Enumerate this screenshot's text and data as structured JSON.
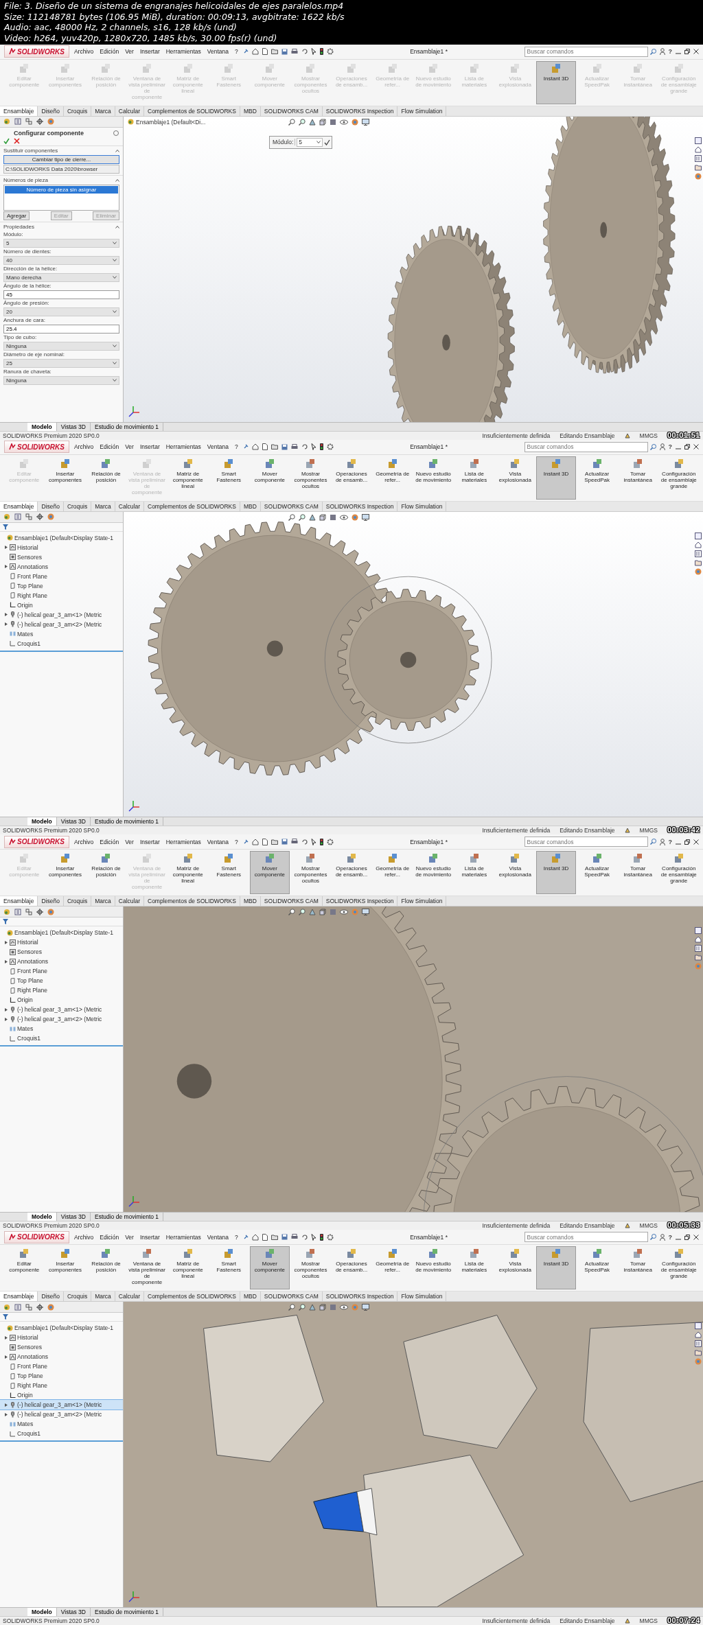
{
  "file_info": [
    "File: 3. Diseño de un sistema de engranajes helicoidales de ejes paralelos.mp4",
    "Size: 112148781 bytes (106.95 MiB), duration: 00:09:13, avgbitrate: 1622 kb/s",
    "Audio: aac, 48000 Hz, 2 channels, s16, 128 kb/s (und)",
    "Video: h264, yuv420p, 1280x720, 1485 kb/s, 30.00 fps(r) (und)"
  ],
  "frames": [
    {
      "timestamp": "00:01:51",
      "logo_text": "SOLIDWORKS",
      "menus": [
        "Archivo",
        "Edición",
        "Ver",
        "Insertar",
        "Herramientas",
        "Ventana",
        "?"
      ],
      "document_title": "Ensamblaje1 *",
      "search_placeholder": "Buscar comandos",
      "help_label": "?",
      "ribbon": [
        {
          "label": "Editar componente",
          "disabled": true,
          "selected": false
        },
        {
          "label": "Insertar componentes",
          "disabled": true,
          "selected": false
        },
        {
          "label": "Relación de posición",
          "disabled": true,
          "selected": false
        },
        {
          "label": "Ventana de vista preliminar de componente",
          "disabled": true,
          "selected": false
        },
        {
          "label": "Matriz de componente lineal",
          "disabled": true,
          "selected": false
        },
        {
          "label": "Smart Fasteners",
          "disabled": true,
          "selected": false
        },
        {
          "label": "Mover componente",
          "disabled": true,
          "selected": false
        },
        {
          "label": "Mostrar componentes ocultos",
          "disabled": true,
          "selected": false
        },
        {
          "label": "Operaciones de ensamb...",
          "disabled": true,
          "selected": false
        },
        {
          "label": "Geometría de refer...",
          "disabled": true,
          "selected": false
        },
        {
          "label": "Nuevo estudio de movimiento",
          "disabled": true,
          "selected": false
        },
        {
          "label": "Lista de materiales",
          "disabled": true,
          "selected": false
        },
        {
          "label": "Vista explosionada",
          "disabled": true,
          "selected": false
        },
        {
          "label": "Instant 3D",
          "disabled": false,
          "selected": true
        },
        {
          "label": "Actualizar SpeedPak",
          "disabled": true,
          "selected": false
        },
        {
          "label": "Tomar instantánea",
          "disabled": true,
          "selected": false
        },
        {
          "label": "Configuración de ensamblaje grande",
          "disabled": true,
          "selected": false
        }
      ],
      "tabs": [
        {
          "label": "Ensamblaje",
          "selected": true
        },
        {
          "label": "Diseño",
          "selected": false
        },
        {
          "label": "Croquis",
          "selected": false
        },
        {
          "label": "Marca",
          "selected": false
        },
        {
          "label": "Calcular",
          "selected": false
        },
        {
          "label": "Complementos de SOLIDWORKS",
          "selected": false
        },
        {
          "label": "MBD",
          "selected": false
        },
        {
          "label": "SOLIDWORKS CAM",
          "selected": false
        },
        {
          "label": "SOLIDWORKS Inspection",
          "selected": false
        },
        {
          "label": "Flow Simulation",
          "selected": false
        }
      ],
      "left_panel": {
        "kind": "property_manager",
        "title": "Configurar componente",
        "sections": [
          {
            "kind": "replace",
            "title": "Sustituir componentes",
            "button": "Cambiar tipo de cierre...",
            "path": "C:\\SOLIDWORKS Data 2020\\browser"
          },
          {
            "kind": "list",
            "title": "Números de pieza",
            "items": [
              {
                "label": "Número de pieza sin asignar",
                "selected": true
              }
            ],
            "buttons": [
              {
                "label": "Agregar",
                "disabled": false
              },
              {
                "label": "Editar",
                "disabled": true
              },
              {
                "label": "Eliminar",
                "disabled": true
              }
            ]
          },
          {
            "kind": "fields",
            "title": "Propiedades",
            "fields": [
              {
                "kind": "select",
                "label": "Módulo:",
                "value": "5"
              },
              {
                "kind": "select",
                "label": "Número de dientes:",
                "value": "40"
              },
              {
                "kind": "select",
                "label": "Dirección de la hélice:",
                "value": "Mano derecha"
              },
              {
                "kind": "input",
                "label": "Ángulo de la hélice:",
                "value": "45"
              },
              {
                "kind": "select",
                "label": "Ángulo de presión:",
                "value": "20"
              },
              {
                "kind": "input",
                "label": "Anchura de cara:",
                "value": "25.4"
              },
              {
                "kind": "select",
                "label": "Tipo de cubo:",
                "value": "Ninguna"
              },
              {
                "kind": "select",
                "label": "Diámetro de eje nominal:",
                "value": "25"
              },
              {
                "kind": "select",
                "label": "Ranura de chaveta:",
                "value": "Ninguna"
              }
            ]
          }
        ]
      },
      "viewport": {
        "kind": "side-pair",
        "breadcrumb": "Ensamblaje1 (Default<Di...",
        "popup": {
          "label": "Módulo:",
          "value": "5"
        }
      },
      "bottom_tabs": [
        {
          "label": "Modelo",
          "selected": true
        },
        {
          "label": "Vistas 3D",
          "selected": false
        },
        {
          "label": "Estudio de movimiento 1",
          "selected": false
        }
      ],
      "status": {
        "product": "SOLIDWORKS Premium 2020 SP0.0",
        "items": [
          "Insuficientemente definida",
          "Editando Ensamblaje"
        ],
        "units": "MMGS"
      }
    },
    {
      "timestamp": "00:03:42",
      "logo_text": "SOLIDWORKS",
      "menus": [
        "Archivo",
        "Edición",
        "Ver",
        "Insertar",
        "Herramientas",
        "Ventana",
        "?"
      ],
      "document_title": "Ensamblaje1 *",
      "search_placeholder": "Buscar comandos",
      "help_label": "?",
      "ribbon": [
        {
          "label": "Editar componente",
          "disabled": true,
          "selected": false
        },
        {
          "label": "Insertar componentes",
          "disabled": false,
          "selected": false
        },
        {
          "label": "Relación de posición",
          "disabled": false,
          "selected": false
        },
        {
          "label": "Ventana de vista preliminar de componente",
          "disabled": true,
          "selected": false
        },
        {
          "label": "Matriz de componente lineal",
          "disabled": false,
          "selected": false
        },
        {
          "label": "Smart Fasteners",
          "disabled": false,
          "selected": false
        },
        {
          "label": "Mover componente",
          "disabled": false,
          "selected": false
        },
        {
          "label": "Mostrar componentes ocultos",
          "disabled": false,
          "selected": false
        },
        {
          "label": "Operaciones de ensamb...",
          "disabled": false,
          "selected": false
        },
        {
          "label": "Geometría de refer...",
          "disabled": false,
          "selected": false
        },
        {
          "label": "Nuevo estudio de movimiento",
          "disabled": false,
          "selected": false
        },
        {
          "label": "Lista de materiales",
          "disabled": false,
          "selected": false
        },
        {
          "label": "Vista explosionada",
          "disabled": false,
          "selected": false
        },
        {
          "label": "Instant 3D",
          "disabled": false,
          "selected": true
        },
        {
          "label": "Actualizar SpeedPak",
          "disabled": false,
          "selected": false
        },
        {
          "label": "Tomar instantánea",
          "disabled": false,
          "selected": false
        },
        {
          "label": "Configuración de ensamblaje grande",
          "disabled": false,
          "selected": false
        }
      ],
      "tabs": [
        {
          "label": "Ensamblaje",
          "selected": true
        },
        {
          "label": "Diseño",
          "selected": false
        },
        {
          "label": "Croquis",
          "selected": false
        },
        {
          "label": "Marca",
          "selected": false
        },
        {
          "label": "Calcular",
          "selected": false
        },
        {
          "label": "Complementos de SOLIDWORKS",
          "selected": false
        },
        {
          "label": "MBD",
          "selected": false
        },
        {
          "label": "SOLIDWORKS CAM",
          "selected": false
        },
        {
          "label": "SOLIDWORKS Inspection",
          "selected": false
        },
        {
          "label": "Flow Simulation",
          "selected": false
        }
      ],
      "left_panel": {
        "kind": "feature_tree",
        "tree": [
          {
            "kind": "assembly",
            "label": "Ensamblaje1  (Default<Display State-1",
            "expandable": false,
            "selected": false,
            "children": [
              {
                "kind": "history",
                "label": "Historial",
                "expandable": true,
                "selected": false
              },
              {
                "kind": "sensor",
                "label": "Sensores",
                "expandable": false,
                "selected": false
              },
              {
                "kind": "annotation",
                "label": "Annotations",
                "expandable": true,
                "selected": false
              },
              {
                "kind": "plane",
                "label": "Front Plane",
                "expandable": false,
                "selected": false
              },
              {
                "kind": "plane",
                "label": "Top Plane",
                "expandable": false,
                "selected": false
              },
              {
                "kind": "plane",
                "label": "Right Plane",
                "expandable": false,
                "selected": false
              },
              {
                "kind": "origin",
                "label": "Origin",
                "expandable": false,
                "selected": false
              },
              {
                "kind": "part",
                "label": "(-) helical gear_3_am<1> (Metric",
                "expandable": true,
                "selected": false
              },
              {
                "kind": "part",
                "label": "(-) helical gear_3_am<2> (Metric",
                "expandable": true,
                "selected": false
              },
              {
                "kind": "mates",
                "label": "Mates",
                "expandable": false,
                "selected": false
              },
              {
                "kind": "sketch",
                "label": "Croquis1",
                "expandable": false,
                "selected": false
              }
            ]
          }
        ]
      },
      "viewport": {
        "kind": "front-pair"
      },
      "bottom_tabs": [
        {
          "label": "Modelo",
          "selected": true
        },
        {
          "label": "Vistas 3D",
          "selected": false
        },
        {
          "label": "Estudio de movimiento 1",
          "selected": false
        }
      ],
      "status": {
        "product": "SOLIDWORKS Premium 2020 SP0.0",
        "items": [
          "Insuficientemente definida",
          "Editando Ensamblaje"
        ],
        "units": "MMGS"
      }
    },
    {
      "timestamp": "00:05:33",
      "logo_text": "SOLIDWORKS",
      "menus": [
        "Archivo",
        "Edición",
        "Ver",
        "Insertar",
        "Herramientas",
        "Ventana",
        "?"
      ],
      "document_title": "Ensamblaje1 *",
      "search_placeholder": "Buscar comandos",
      "help_label": "?",
      "ribbon": [
        {
          "label": "Editar componente",
          "disabled": true,
          "selected": false
        },
        {
          "label": "Insertar componentes",
          "disabled": false,
          "selected": false
        },
        {
          "label": "Relación de posición",
          "disabled": false,
          "selected": false
        },
        {
          "label": "Ventana de vista preliminar de componente",
          "disabled": true,
          "selected": false
        },
        {
          "label": "Matriz de componente lineal",
          "disabled": false,
          "selected": false
        },
        {
          "label": "Smart Fasteners",
          "disabled": false,
          "selected": false
        },
        {
          "label": "Mover componente",
          "disabled": false,
          "selected": true
        },
        {
          "label": "Mostrar componentes ocultos",
          "disabled": false,
          "selected": false
        },
        {
          "label": "Operaciones de ensamb...",
          "disabled": false,
          "selected": false
        },
        {
          "label": "Geometría de refer...",
          "disabled": false,
          "selected": false
        },
        {
          "label": "Nuevo estudio de movimiento",
          "disabled": false,
          "selected": false
        },
        {
          "label": "Lista de materiales",
          "disabled": false,
          "selected": false
        },
        {
          "label": "Vista explosionada",
          "disabled": false,
          "selected": false
        },
        {
          "label": "Instant 3D",
          "disabled": false,
          "selected": true
        },
        {
          "label": "Actualizar SpeedPak",
          "disabled": false,
          "selected": false
        },
        {
          "label": "Tomar instantánea",
          "disabled": false,
          "selected": false
        },
        {
          "label": "Configuración de ensamblaje grande",
          "disabled": false,
          "selected": false
        }
      ],
      "tabs": [
        {
          "label": "Ensamblaje",
          "selected": true
        },
        {
          "label": "Diseño",
          "selected": false
        },
        {
          "label": "Croquis",
          "selected": false
        },
        {
          "label": "Marca",
          "selected": false
        },
        {
          "label": "Calcular",
          "selected": false
        },
        {
          "label": "Complementos de SOLIDWORKS",
          "selected": false
        },
        {
          "label": "MBD",
          "selected": false
        },
        {
          "label": "SOLIDWORKS CAM",
          "selected": false
        },
        {
          "label": "SOLIDWORKS Inspection",
          "selected": false
        },
        {
          "label": "Flow Simulation",
          "selected": false
        }
      ],
      "left_panel": {
        "kind": "feature_tree",
        "tree": [
          {
            "kind": "assembly",
            "label": "Ensamblaje1  (Default<Display State-1",
            "expandable": false,
            "selected": false,
            "children": [
              {
                "kind": "history",
                "label": "Historial",
                "expandable": true,
                "selected": false
              },
              {
                "kind": "sensor",
                "label": "Sensores",
                "expandable": false,
                "selected": false
              },
              {
                "kind": "annotation",
                "label": "Annotations",
                "expandable": true,
                "selected": false
              },
              {
                "kind": "plane",
                "label": "Front Plane",
                "expandable": false,
                "selected": false
              },
              {
                "kind": "plane",
                "label": "Top Plane",
                "expandable": false,
                "selected": false
              },
              {
                "kind": "plane",
                "label": "Right Plane",
                "expandable": false,
                "selected": false
              },
              {
                "kind": "origin",
                "label": "Origin",
                "expandable": false,
                "selected": false
              },
              {
                "kind": "part",
                "label": "(-) helical gear_3_am<1> (Metric",
                "expandable": true,
                "selected": false
              },
              {
                "kind": "part",
                "label": "(-) helical gear_3_am<2> (Metric",
                "expandable": true,
                "selected": false
              },
              {
                "kind": "mates",
                "label": "Mates",
                "expandable": false,
                "selected": false
              },
              {
                "kind": "sketch",
                "label": "Croquis1",
                "expandable": false,
                "selected": false
              }
            ]
          }
        ]
      },
      "viewport": {
        "kind": "closeup"
      },
      "bottom_tabs": [
        {
          "label": "Modelo",
          "selected": true
        },
        {
          "label": "Vistas 3D",
          "selected": false
        },
        {
          "label": "Estudio de movimiento 1",
          "selected": false
        }
      ],
      "status": {
        "product": "SOLIDWORKS Premium 2020 SP0.0",
        "items": [
          "Insuficientemente definida",
          "Editando Ensamblaje"
        ],
        "units": "MMGS"
      }
    },
    {
      "timestamp": "00:07:24",
      "logo_text": "SOLIDWORKS",
      "menus": [
        "Archivo",
        "Edición",
        "Ver",
        "Insertar",
        "Herramientas",
        "Ventana",
        "?"
      ],
      "document_title": "Ensamblaje1 *",
      "search_placeholder": "Buscar comandos",
      "help_label": "?",
      "ribbon": [
        {
          "label": "Editar componente",
          "disabled": false,
          "selected": false
        },
        {
          "label": "Insertar componentes",
          "disabled": false,
          "selected": false
        },
        {
          "label": "Relación de posición",
          "disabled": false,
          "selected": false
        },
        {
          "label": "Ventana de vista preliminar de componente",
          "disabled": false,
          "selected": false
        },
        {
          "label": "Matriz de componente lineal",
          "disabled": false,
          "selected": false
        },
        {
          "label": "Smart Fasteners",
          "disabled": false,
          "selected": false
        },
        {
          "label": "Mover componente",
          "disabled": false,
          "selected": true
        },
        {
          "label": "Mostrar componentes ocultos",
          "disabled": false,
          "selected": false
        },
        {
          "label": "Operaciones de ensamb...",
          "disabled": false,
          "selected": false
        },
        {
          "label": "Geometría de refer...",
          "disabled": false,
          "selected": false
        },
        {
          "label": "Nuevo estudio de movimiento",
          "disabled": false,
          "selected": false
        },
        {
          "label": "Lista de materiales",
          "disabled": false,
          "selected": false
        },
        {
          "label": "Vista explosionada",
          "disabled": false,
          "selected": false
        },
        {
          "label": "Instant 3D",
          "disabled": false,
          "selected": true
        },
        {
          "label": "Actualizar SpeedPak",
          "disabled": false,
          "selected": false
        },
        {
          "label": "Tomar instantánea",
          "disabled": false,
          "selected": false
        },
        {
          "label": "Configuración de ensamblaje grande",
          "disabled": false,
          "selected": false
        }
      ],
      "tabs": [
        {
          "label": "Ensamblaje",
          "selected": true
        },
        {
          "label": "Diseño",
          "selected": false
        },
        {
          "label": "Croquis",
          "selected": false
        },
        {
          "label": "Marca",
          "selected": false
        },
        {
          "label": "Calcular",
          "selected": false
        },
        {
          "label": "Complementos de SOLIDWORKS",
          "selected": false
        },
        {
          "label": "MBD",
          "selected": false
        },
        {
          "label": "SOLIDWORKS CAM",
          "selected": false
        },
        {
          "label": "SOLIDWORKS Inspection",
          "selected": false
        },
        {
          "label": "Flow Simulation",
          "selected": false
        }
      ],
      "left_panel": {
        "kind": "feature_tree",
        "tree": [
          {
            "kind": "assembly",
            "label": "Ensamblaje1  (Default<Display State-1",
            "expandable": false,
            "selected": false,
            "children": [
              {
                "kind": "history",
                "label": "Historial",
                "expandable": true,
                "selected": false
              },
              {
                "kind": "sensor",
                "label": "Sensores",
                "expandable": false,
                "selected": false
              },
              {
                "kind": "annotation",
                "label": "Annotations",
                "expandable": true,
                "selected": false
              },
              {
                "kind": "plane",
                "label": "Front Plane",
                "expandable": false,
                "selected": false
              },
              {
                "kind": "plane",
                "label": "Top Plane",
                "expandable": false,
                "selected": false
              },
              {
                "kind": "plane",
                "label": "Right Plane",
                "expandable": false,
                "selected": false
              },
              {
                "kind": "origin",
                "label": "Origin",
                "expandable": false,
                "selected": false
              },
              {
                "kind": "part",
                "label": "(-) helical gear_3_am<1> (Metric",
                "expandable": true,
                "selected": true
              },
              {
                "kind": "part",
                "label": "(-) helical gear_3_am<2> (Metric",
                "expandable": true,
                "selected": false
              },
              {
                "kind": "mates",
                "label": "Mates",
                "expandable": false,
                "selected": false
              },
              {
                "kind": "sketch",
                "label": "Croquis1",
                "expandable": false,
                "selected": false
              }
            ]
          }
        ]
      },
      "viewport": {
        "kind": "tooth-closeup"
      },
      "bottom_tabs": [
        {
          "label": "Modelo",
          "selected": true
        },
        {
          "label": "Vistas 3D",
          "selected": false
        },
        {
          "label": "Estudio de movimiento 1",
          "selected": false
        }
      ],
      "status": {
        "product": "SOLIDWORKS Premium 2020 SP0.0",
        "items": [
          "Insuficientemente definida",
          "Editando Ensamblaje"
        ],
        "units": "MMGS"
      }
    }
  ]
}
